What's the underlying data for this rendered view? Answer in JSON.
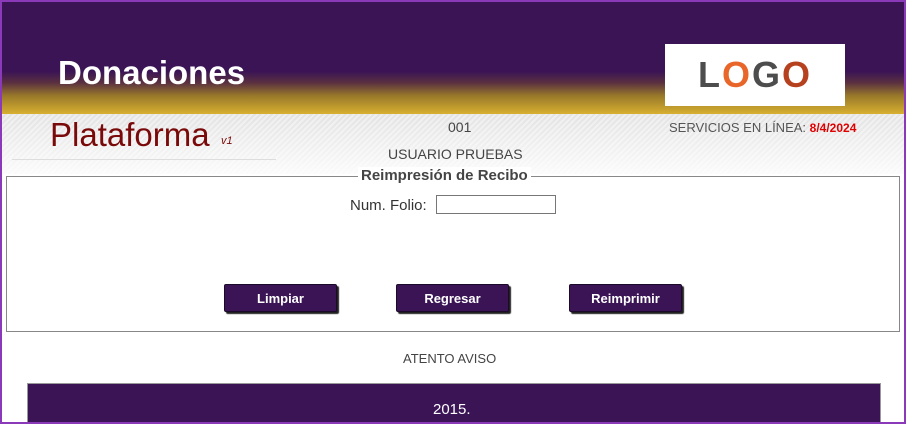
{
  "header": {
    "title": "Donaciones",
    "logo": [
      "L",
      "O",
      "G",
      "O"
    ]
  },
  "subheader": {
    "platform_title": "Plataforma",
    "platform_version": "v1",
    "branch_code": "001",
    "user_name": "USUARIO PRUEBAS",
    "services_label": "SERVICIOS EN LÍNEA:",
    "services_date": "8/4/2024"
  },
  "form": {
    "legend": "Reimpresión de Recibo",
    "folio_label": "Num. Folio:",
    "folio_value": "",
    "buttons": {
      "clear": "Limpiar",
      "back": "Regresar",
      "reprint": "Reimprimir"
    }
  },
  "notice": {
    "title": "ATENTO AVISO",
    "text": "2015."
  },
  "colors": {
    "brand_purple": "#3b1456",
    "accent_gold": "#d8b030",
    "platform_red": "#7a0a0a",
    "date_red": "#e00000"
  }
}
